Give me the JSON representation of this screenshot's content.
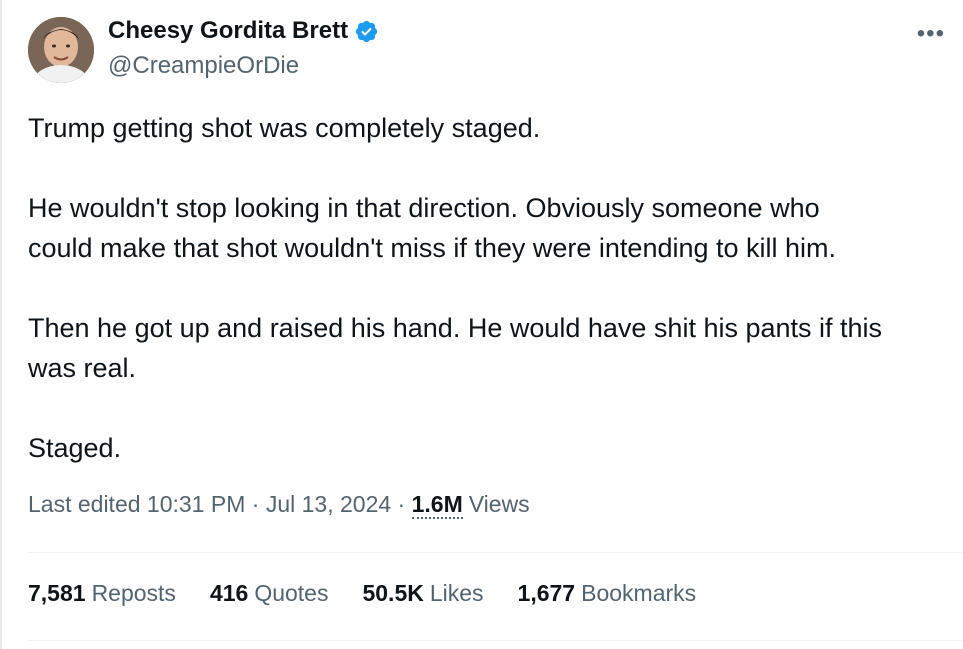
{
  "author": {
    "display_name": "Cheesy Gordita Brett",
    "handle": "@CreampieOrDie",
    "verified": true
  },
  "tweet": {
    "paragraphs": [
      "Trump getting shot was completely staged.",
      "He wouldn't stop looking in that direction. Obviously someone who\ncould make that shot wouldn't miss if they were intending to kill him.",
      "Then he got up and raised his hand. He would have shit his pants if this\nwas real.",
      "Staged."
    ]
  },
  "meta": {
    "edited_prefix": "Last edited",
    "time": "10:31 PM",
    "separator": "·",
    "date": "Jul 13, 2024",
    "views_count": "1.6M",
    "views_label": "Views"
  },
  "stats": {
    "reposts": {
      "count": "7,581",
      "label": "Reposts"
    },
    "quotes": {
      "count": "416",
      "label": "Quotes"
    },
    "likes": {
      "count": "50.5K",
      "label": "Likes"
    },
    "bookmarks": {
      "count": "1,677",
      "label": "Bookmarks"
    }
  },
  "icons": {
    "more": "more-horizontal-icon",
    "verified": "verified-badge-icon"
  },
  "colors": {
    "primary_text": "#0f1419",
    "secondary_text": "#536471",
    "verified_blue": "#1d9bf0",
    "divider": "#eff3f4"
  }
}
